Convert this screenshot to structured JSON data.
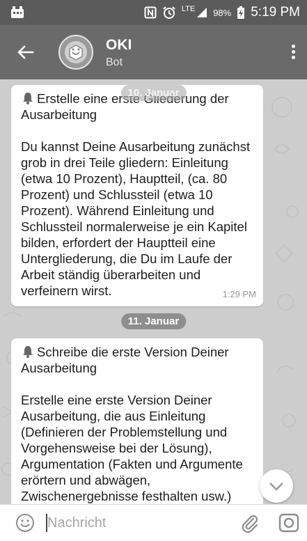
{
  "status_bar": {
    "time": "5:19 PM",
    "battery": "98%",
    "network": "LTE",
    "icons": [
      "nfc-icon",
      "alarm-icon",
      "signal-icon",
      "battery-charging-icon"
    ]
  },
  "app_bar": {
    "title": "OKI",
    "subtitle": "Bot"
  },
  "messages": [
    {
      "date_chip": "10. Januar",
      "heading": "Erstelle eine erste Gliederung der Ausarbeitung",
      "body": "Du kannst Deine Ausarbeitung zunächst grob in drei Teile gliedern: Einleitung (etwa 10 Prozent), Hauptteil, (ca. 80 Prozent) und Schlussteil (etwa 10 Prozent). Während Einleitung und Schlussteil normalerweise je ein Kapitel bilden, erfordert der Hauptteil eine Untergliederung, die Du im Laufe der Arbeit ständig überarbeiten und verfeinern wirst.",
      "time": "1:29 PM"
    },
    {
      "date_chip": "11. Januar",
      "heading": "Schreibe die erste Version Deiner Ausarbeitung",
      "body": "Erstelle eine erste Version Deiner Ausarbeitung, die aus Einleitung (Definieren der Problemstellung und Vorgehensweise bei der Lösung), Argumentation (Fakten und Argumente erörtern und abwägen, Zwischenergebnisse festhalten usw.) und Schluss (Ergebnis(se)"
    }
  ],
  "input": {
    "placeholder": "Nachricht"
  },
  "colors": {
    "app_bar": "#6a6a6a",
    "status_bar": "#5b5b5b",
    "chat_bg": "#cdcdcd",
    "bubble": "#ffffff"
  }
}
